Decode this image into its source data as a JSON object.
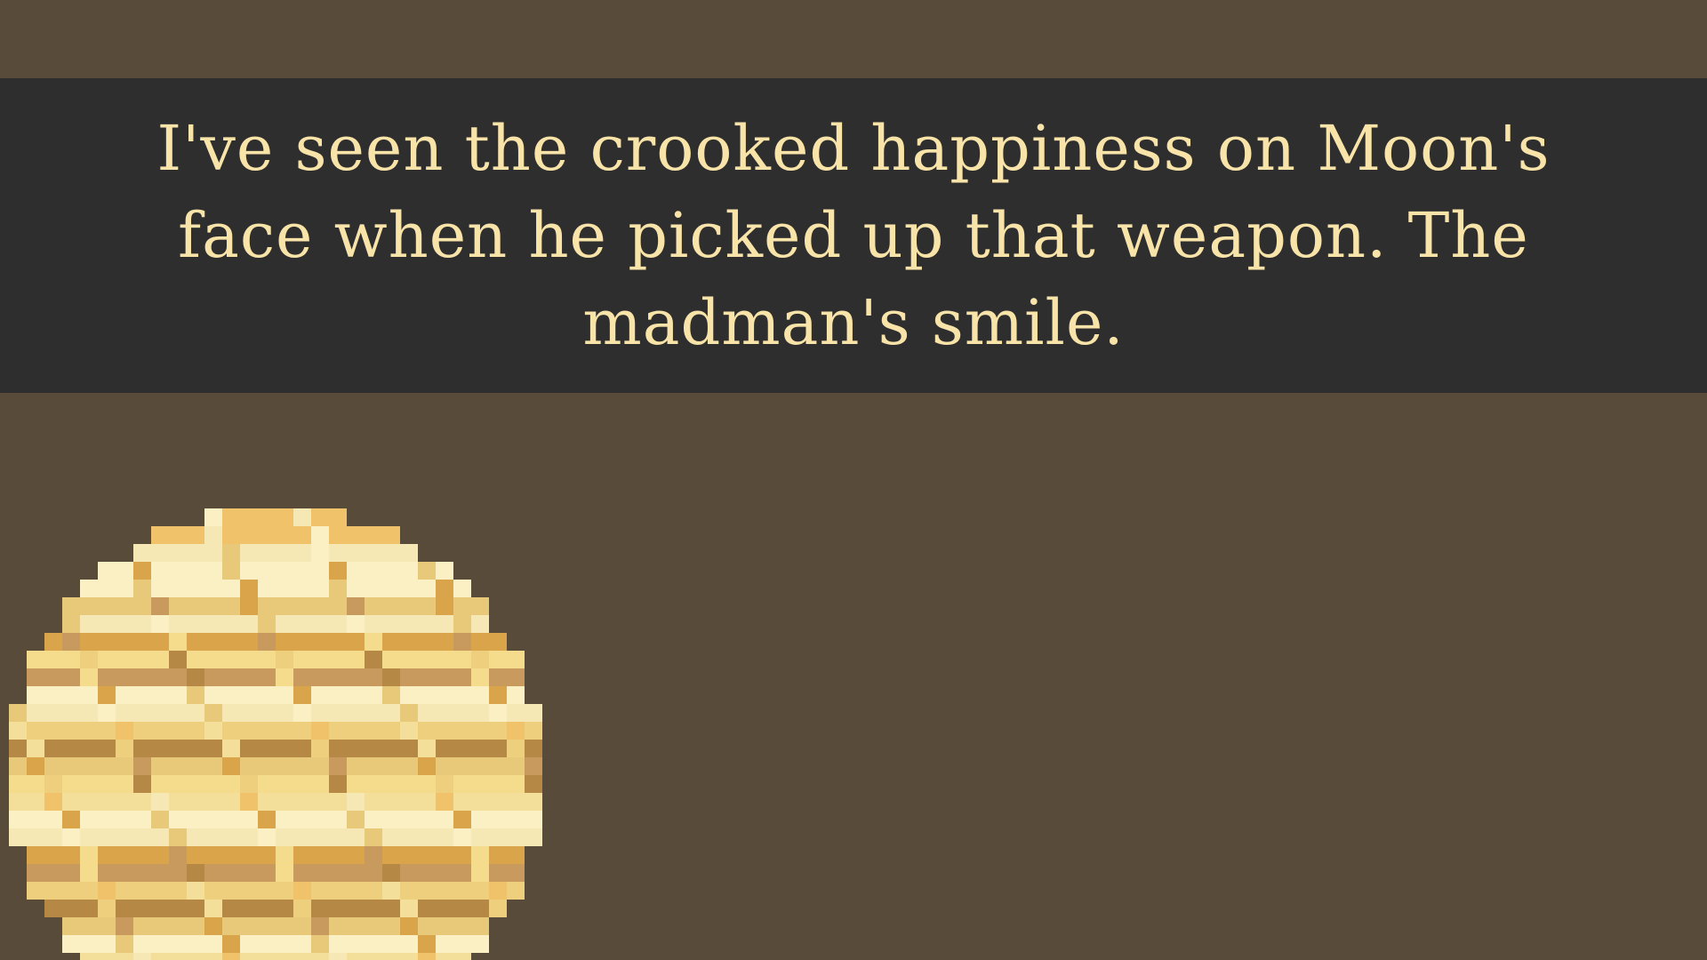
{
  "dialogue": {
    "text": "I've seen the crooked happiness on Moon's face when he picked up that weapon. The madman's smile."
  },
  "colors": {
    "background": "#594b39",
    "dialogue_box": "#2e2e2e",
    "dialogue_text": "#f8e3a8"
  },
  "planet": {
    "icon": "pixel-gas-giant-planet-icon",
    "palette": [
      "#f0c26a",
      "#f6e8b4",
      "#fbf0c4",
      "#e8c97a",
      "#d9a44a",
      "#c99a5e",
      "#f5dc8c",
      "#b68845",
      "#eecf7e",
      "#f3df9a"
    ]
  }
}
